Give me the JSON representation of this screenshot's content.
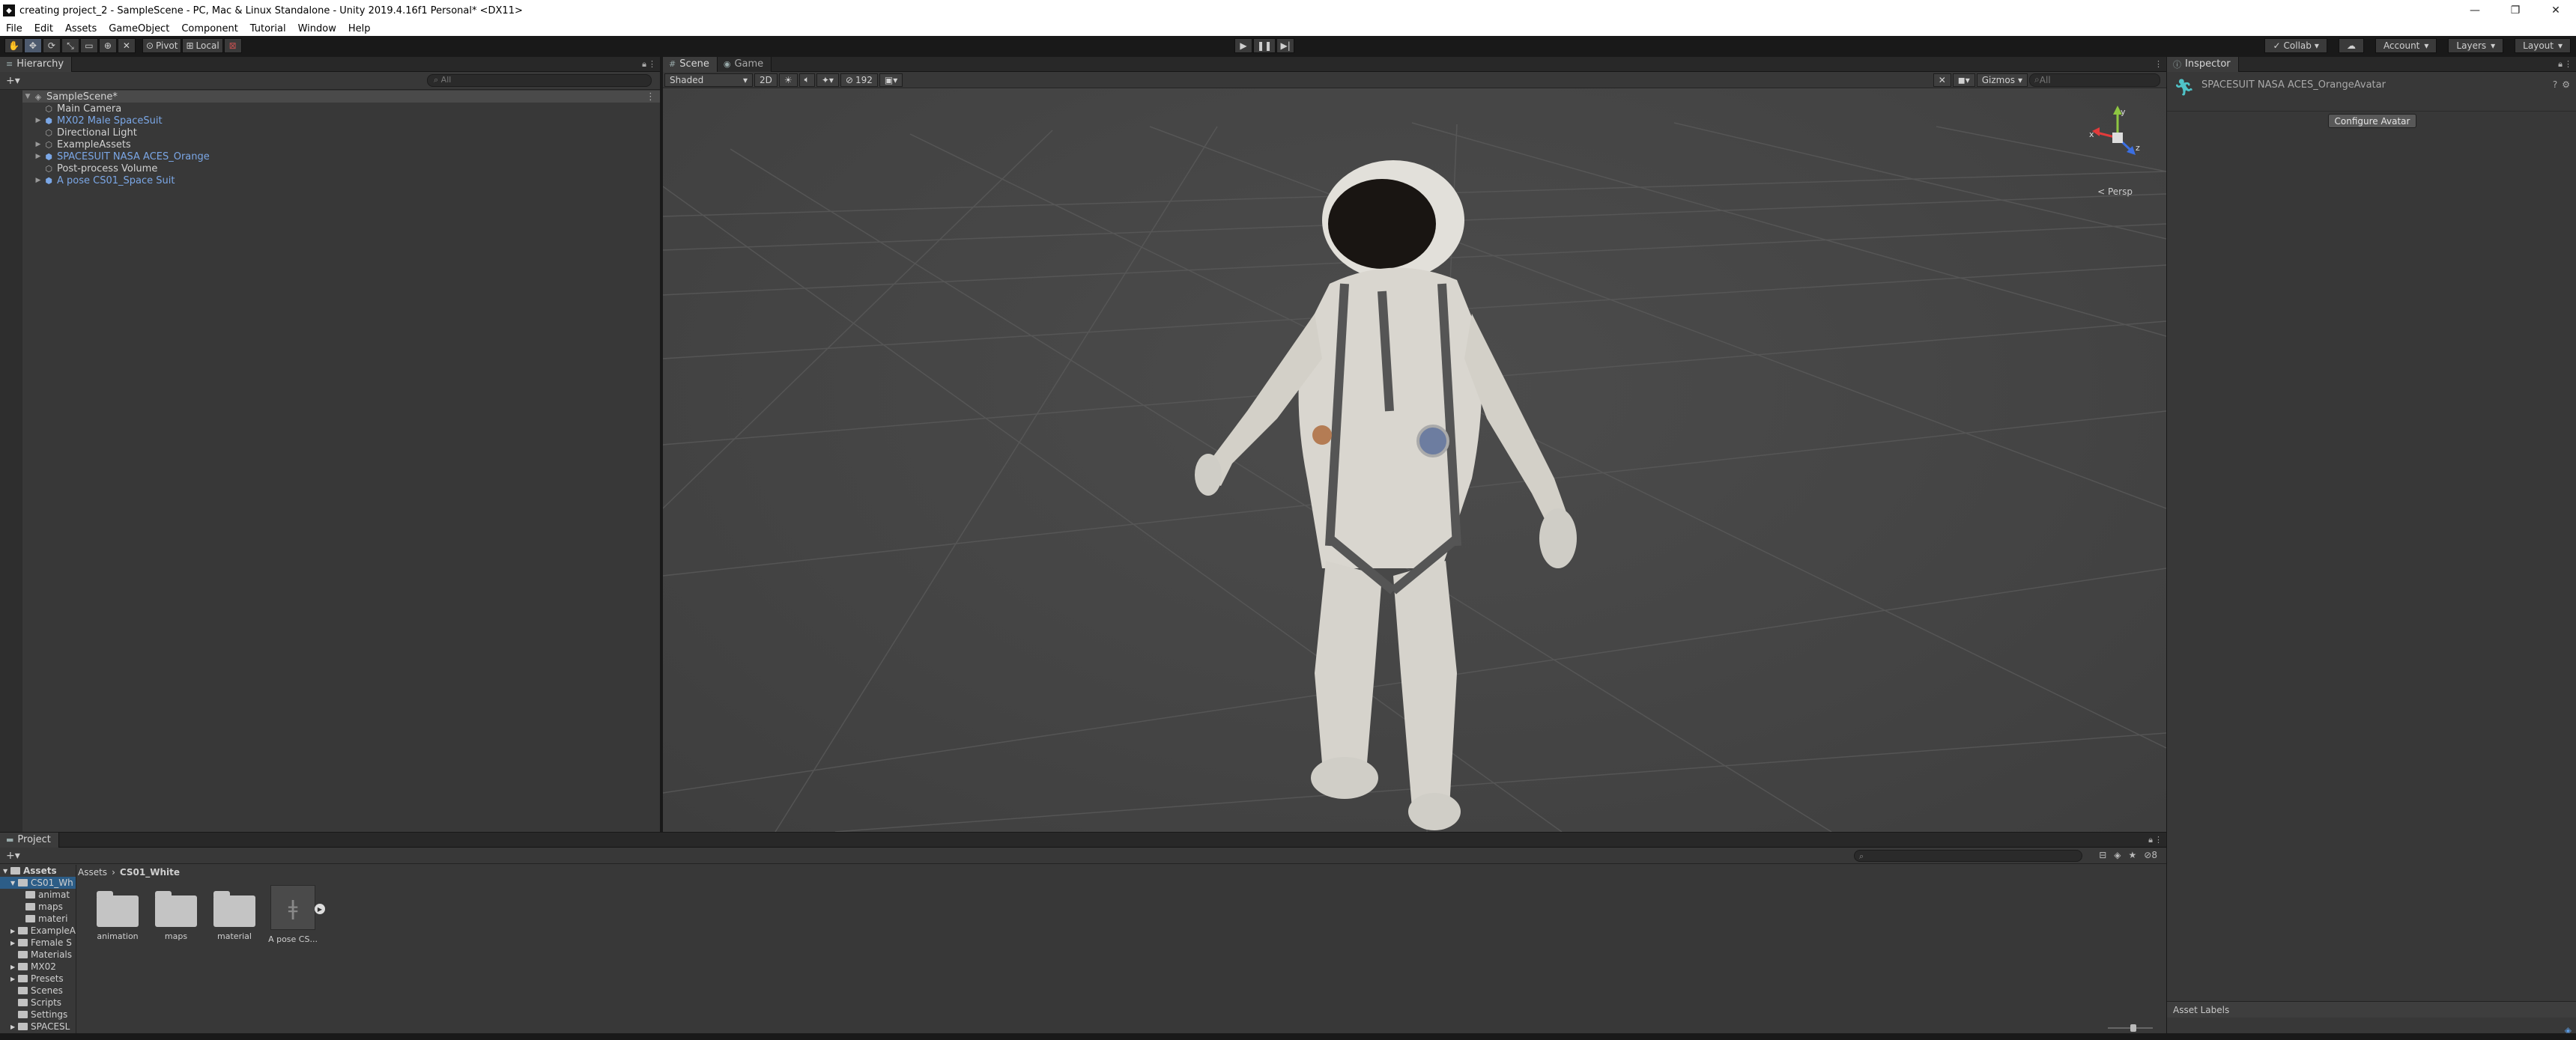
{
  "window": {
    "title": "creating project_2 - SampleScene - PC, Mac & Linux Standalone - Unity 2019.4.16f1 Personal* <DX11>",
    "controls": [
      "—",
      "❐",
      "✕"
    ]
  },
  "menu": [
    "File",
    "Edit",
    "Assets",
    "GameObject",
    "Component",
    "Tutorial",
    "Window",
    "Help"
  ],
  "toolbar": {
    "pivot": "Pivot",
    "local": "Local",
    "collab": "Collab",
    "account": "Account",
    "layers": "Layers",
    "layout": "Layout"
  },
  "hierarchy": {
    "tab": "Hierarchy",
    "search_placeholder": "All",
    "scene": "SampleScene*",
    "items": [
      {
        "label": "Main Camera",
        "prefab": false,
        "expandable": false
      },
      {
        "label": "MX02 Male SpaceSuit",
        "prefab": true,
        "expandable": true
      },
      {
        "label": "Directional Light",
        "prefab": false,
        "expandable": false
      },
      {
        "label": "ExampleAssets",
        "prefab": false,
        "expandable": true
      },
      {
        "label": "SPACESUIT NASA ACES_Orange",
        "prefab": true,
        "expandable": true
      },
      {
        "label": "Post-process Volume",
        "prefab": false,
        "expandable": false
      },
      {
        "label": "A pose CS01_Space Suit",
        "prefab": true,
        "expandable": true
      }
    ]
  },
  "scene": {
    "tabs": [
      "Scene",
      "Game"
    ],
    "shading": "Shaded",
    "mode2d": "2D",
    "hidden_count": "192",
    "gizmos": "Gizmos",
    "search_placeholder": "All",
    "persp": "< Persp"
  },
  "inspector": {
    "tab": "Inspector",
    "object_name": "SPACESUIT NASA ACES_OrangeAvatar",
    "configure_button": "Configure Avatar",
    "asset_labels": "Asset Labels"
  },
  "project": {
    "tab": "Project",
    "tree": [
      {
        "label": "Assets",
        "level": 0,
        "bold": true,
        "selected": false
      },
      {
        "label": "CS01_Wh",
        "level": 1,
        "bold": false,
        "selected": true
      },
      {
        "label": "animat",
        "level": 2,
        "bold": false,
        "selected": false
      },
      {
        "label": "maps",
        "level": 2,
        "bold": false,
        "selected": false
      },
      {
        "label": "materi",
        "level": 2,
        "bold": false,
        "selected": false
      },
      {
        "label": "ExampleA",
        "level": 1,
        "bold": false,
        "selected": false
      },
      {
        "label": "Female S",
        "level": 1,
        "bold": false,
        "selected": false
      },
      {
        "label": "Materials",
        "level": 1,
        "bold": false,
        "selected": false
      },
      {
        "label": "MX02",
        "level": 1,
        "bold": false,
        "selected": false
      },
      {
        "label": "Presets",
        "level": 1,
        "bold": false,
        "selected": false
      },
      {
        "label": "Scenes",
        "level": 1,
        "bold": false,
        "selected": false
      },
      {
        "label": "Scripts",
        "level": 1,
        "bold": false,
        "selected": false
      },
      {
        "label": "Settings",
        "level": 1,
        "bold": false,
        "selected": false
      },
      {
        "label": "SPACESL",
        "level": 1,
        "bold": false,
        "selected": false
      }
    ],
    "breadcrumb": [
      "Assets",
      "CS01_White"
    ],
    "items": [
      {
        "label": "animation",
        "type": "folder"
      },
      {
        "label": "maps",
        "type": "folder"
      },
      {
        "label": "material",
        "type": "folder"
      },
      {
        "label": "A pose CS...",
        "type": "model"
      }
    ]
  }
}
